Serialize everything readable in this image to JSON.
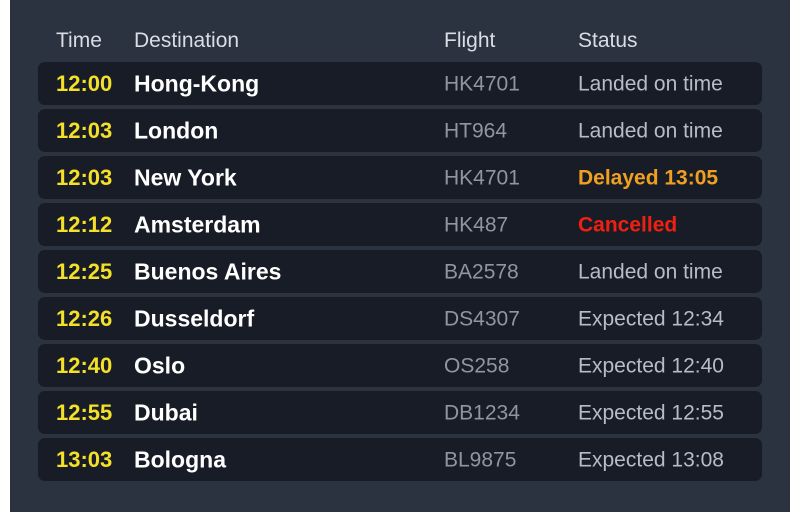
{
  "board": {
    "columns": {
      "time": "Time",
      "destination": "Destination",
      "flight": "Flight",
      "status": "Status"
    },
    "colors": {
      "panel_background": "#2b3340",
      "row_background": "#181c26",
      "time_text": "#f5e028",
      "destination_text": "#ffffff",
      "flight_text": "#8f96a3",
      "status_text": "#b6bcc8",
      "status_delayed": "#f0a020",
      "status_cancelled": "#f02010",
      "header_text": "#d9dde5"
    },
    "rows": [
      {
        "time": "12:00",
        "destination": "Hong-Kong",
        "flight": "HK4701",
        "status": "Landed on time",
        "state": "ontime"
      },
      {
        "time": "12:03",
        "destination": "London",
        "flight": "HT964",
        "status": "Landed on time",
        "state": "ontime"
      },
      {
        "time": "12:03",
        "destination": "New York",
        "flight": "HK4701",
        "status": "Delayed 13:05",
        "state": "delayed"
      },
      {
        "time": "12:12",
        "destination": "Amsterdam",
        "flight": "HK487",
        "status": "Cancelled",
        "state": "cancelled"
      },
      {
        "time": "12:25",
        "destination": "Buenos Aires",
        "flight": "BA2578",
        "status": "Landed on time",
        "state": "ontime"
      },
      {
        "time": "12:26",
        "destination": "Dusseldorf",
        "flight": "DS4307",
        "status": "Expected 12:34",
        "state": "expected"
      },
      {
        "time": "12:40",
        "destination": "Oslo",
        "flight": "OS258",
        "status": "Expected 12:40",
        "state": "expected"
      },
      {
        "time": "12:55",
        "destination": "Dubai",
        "flight": "DB1234",
        "status": "Expected 12:55",
        "state": "expected"
      },
      {
        "time": "13:03",
        "destination": "Bologna",
        "flight": "BL9875",
        "status": "Expected 13:08",
        "state": "expected"
      }
    ]
  }
}
